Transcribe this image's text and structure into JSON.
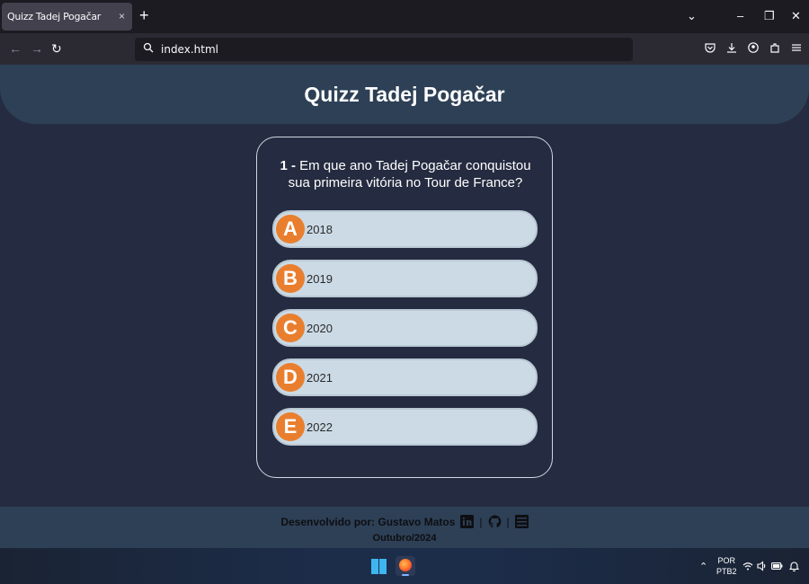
{
  "browser": {
    "tab_title": "Quizz Tadej Pogačar",
    "tab_close": "×",
    "new_tab": "+",
    "url": "index.html",
    "minimize": "–",
    "restore": "❐",
    "close": "✕",
    "chevron": "⌄"
  },
  "page": {
    "title": "Quizz Tadej Pogačar",
    "question": {
      "number": "1 -",
      "text": "Em que ano Tadej Pogačar conquistou sua primeira vitória no Tour de France?"
    },
    "options": [
      {
        "letter": "A",
        "text": "2018"
      },
      {
        "letter": "B",
        "text": "2019"
      },
      {
        "letter": "C",
        "text": "2020"
      },
      {
        "letter": "D",
        "text": "2021"
      },
      {
        "letter": "E",
        "text": "2022"
      }
    ],
    "footer": {
      "developed_by": "Desenvolvido por: Gustavo Matos",
      "separator": "|",
      "date": "Outubro/2024"
    }
  },
  "taskbar": {
    "language": "POR",
    "layout": "PTB2"
  },
  "colors": {
    "accent_orange": "#e97f2e",
    "header_blue": "#2d4056",
    "background": "#252b40",
    "option_bg": "#cbdae5"
  }
}
